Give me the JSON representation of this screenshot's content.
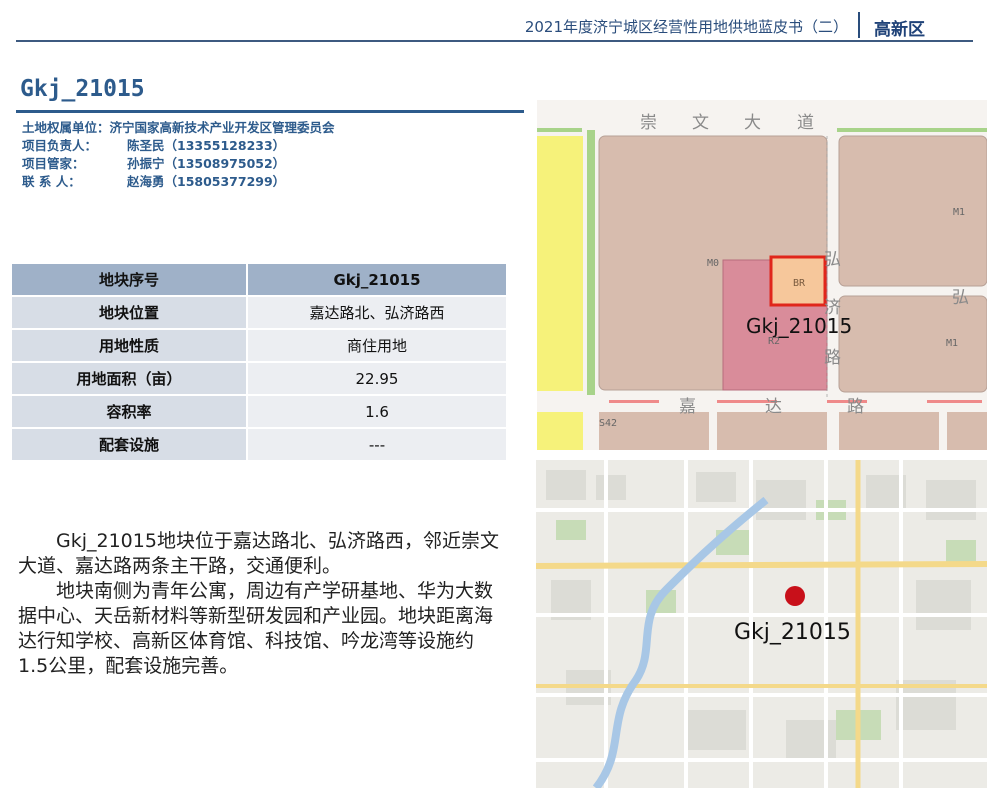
{
  "header": {
    "doc_title": "2021年度济宁城区经营性用地供地蓝皮书（二）",
    "district": "高新区"
  },
  "plot": {
    "title": "Gkj_21015"
  },
  "contacts": {
    "owner_label": "土地权属单位：",
    "owner_value": "济宁国家高新技术产业开发区管理委员会",
    "leader_label": "项目负责人：",
    "leader_value": "陈圣民（13355128233）",
    "manager_label": "项目管家：",
    "manager_value": "孙振宁（13508975052）",
    "contact_label": "联 系 人：",
    "contact_value": "赵海勇（15805377299）"
  },
  "table": {
    "rows": [
      {
        "k": "地块序号",
        "v": "Gkj_21015"
      },
      {
        "k": "地块位置",
        "v": "嘉达路北、弘济路西"
      },
      {
        "k": "用地性质",
        "v": "商住用地"
      },
      {
        "k": "用地面积（亩）",
        "v": "22.95"
      },
      {
        "k": "容积率",
        "v": "1.6"
      },
      {
        "k": "配套设施",
        "v": "---"
      }
    ]
  },
  "description": {
    "p1": "Gkj_21015地块位于嘉达路北、弘济路西，邻近崇文大道、嘉达路两条主干路，交通便利。",
    "p2": "地块南侧为青年公寓，周边有产学研基地、华为大数据中心、天岳新材料等新型研发园和产业园。地块距离海达行知学校、高新区体育馆、科技馆、吟龙湾等设施约1.5公里，配套设施完善。"
  },
  "zoning_map": {
    "plot_label": "Gkj_21015",
    "plot_code": "BR",
    "roads": {
      "north": [
        "崇",
        "文",
        "大",
        "道"
      ],
      "south": [
        "嘉",
        "达",
        "路"
      ],
      "east": [
        "弘",
        "济",
        "路"
      ],
      "east_right": "弘"
    },
    "zone_codes": {
      "m0": "M0",
      "m1_top": "M1",
      "m1_bottom": "M1",
      "r2": "R2",
      "s42": "S42"
    },
    "colors": {
      "industrial": "#d7bcae",
      "residential": "#d98c9a",
      "commercial_residential": "#f6c79b",
      "plot_outline": "#e0261b",
      "green": "#a8d38a",
      "yellow": "#f6f27a"
    }
  },
  "location_map": {
    "plot_label": "Gkj_21015",
    "marker_color": "#c8101a"
  }
}
